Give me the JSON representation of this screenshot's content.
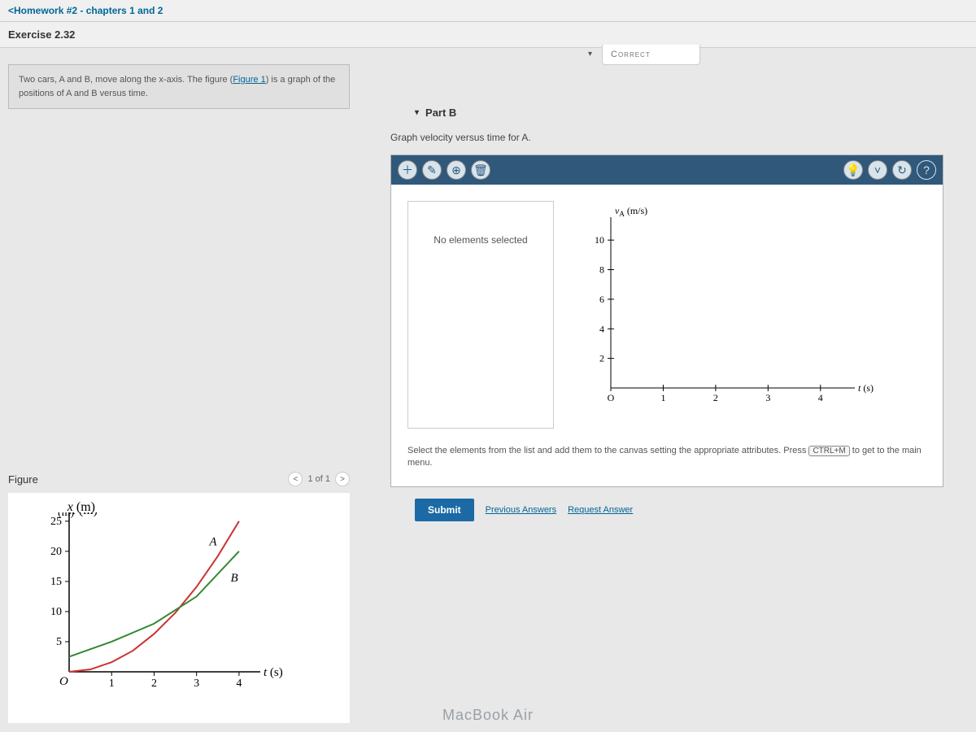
{
  "nav": {
    "back_label": "Homework #2 - chapters 1 and 2"
  },
  "exercise": {
    "title": "Exercise 2.32"
  },
  "problem": {
    "text_before": "Two cars, A and B, move along the x-axis. The figure (",
    "figure_link": "Figure 1",
    "text_after": ") is a graph of the positions of A and B versus time."
  },
  "figure_panel": {
    "title": "Figure",
    "pager": "1 of 1"
  },
  "chart_data": [
    {
      "id": "figure1",
      "type": "line",
      "title": "",
      "xlabel": "t (s)",
      "ylabel": "x (m)",
      "xlim": [
        0,
        4.5
      ],
      "ylim": [
        0,
        27
      ],
      "xticks": [
        1,
        2,
        3,
        4
      ],
      "yticks": [
        5,
        10,
        15,
        20,
        25
      ],
      "series": [
        {
          "name": "A",
          "color": "#cc3333",
          "x": [
            0,
            0.5,
            1,
            1.5,
            2,
            2.5,
            3,
            3.5,
            4
          ],
          "y": [
            0,
            0.4,
            1.6,
            3.5,
            6.3,
            9.8,
            14.1,
            19.2,
            25
          ]
        },
        {
          "name": "B",
          "color": "#338833",
          "x": [
            0,
            1,
            2,
            3,
            4
          ],
          "y": [
            2.5,
            5,
            8,
            12.5,
            20
          ]
        }
      ],
      "annotations": [
        {
          "text": "A",
          "x": 3.3,
          "y": 21
        },
        {
          "text": "B",
          "x": 3.8,
          "y": 15
        }
      ]
    },
    {
      "id": "velocity_canvas",
      "type": "line",
      "title": "",
      "xlabel": "t (s)",
      "ylabel": "v_A (m/s)",
      "xlim": [
        0,
        4.5
      ],
      "ylim": [
        0,
        11
      ],
      "xticks": [
        0,
        1,
        2,
        3,
        4
      ],
      "yticks": [
        2,
        4,
        6,
        8,
        10
      ],
      "series": []
    }
  ],
  "partA_status": "Correct",
  "partB": {
    "label": "Part B",
    "prompt": "Graph velocity versus time for A.",
    "inspector": "No elements selected",
    "hint_before": "Select the elements from the list and add them to the canvas setting the appropriate attributes. Press ",
    "hint_key": "CTRL+M",
    "hint_after": " to get to the main menu.",
    "submit": "Submit",
    "prev": "Previous Answers",
    "request": "Request Answer"
  },
  "device": "MacBook Air"
}
